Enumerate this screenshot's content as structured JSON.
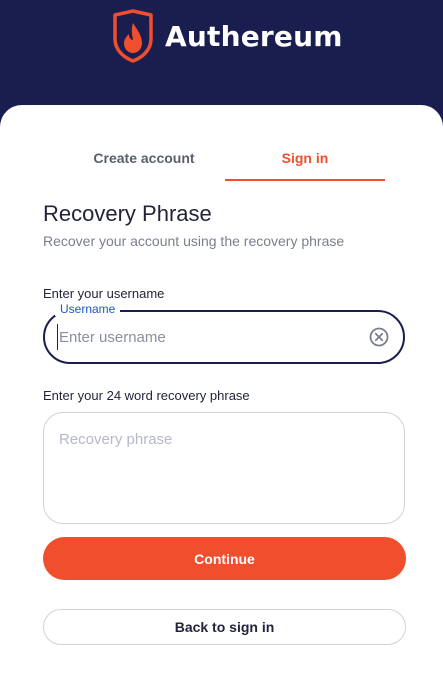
{
  "brand": {
    "name": "Authereum",
    "logo_icon": "authereum-flame-shield-icon"
  },
  "tabs": [
    {
      "label": "Create account",
      "active": false
    },
    {
      "label": "Sign in",
      "active": true
    }
  ],
  "form": {
    "title": "Recovery Phrase",
    "subtitle": "Recover your account using the recovery phrase",
    "username": {
      "label": "Enter your username",
      "floating_label": "Username",
      "value": "",
      "placeholder": "Enter username",
      "clear_icon": "clear-circle-icon"
    },
    "phrase": {
      "label": "Enter your 24 word recovery phrase",
      "value": "",
      "placeholder": "Recovery phrase"
    },
    "continue_label": "Continue",
    "back_label": "Back to sign in"
  },
  "colors": {
    "header_bg": "#1a1e4f",
    "accent": "#f04e2d",
    "focus_label": "#1a56c8"
  }
}
